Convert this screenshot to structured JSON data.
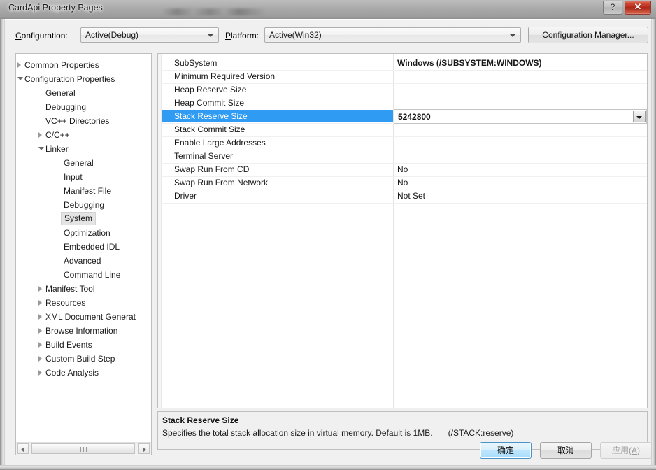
{
  "window": {
    "title": "CardApi Property Pages",
    "help_button": "?",
    "close_button": "✕"
  },
  "configbar": {
    "configuration_label": "Configuration:",
    "configuration_label_accel": "C",
    "configuration_value": "Active(Debug)",
    "platform_label": "Platform:",
    "platform_label_accel": "P",
    "platform_value": "Active(Win32)",
    "config_manager_button": "Configuration Manager...",
    "config_manager_accel": "o"
  },
  "tree": {
    "items": [
      {
        "label": "Common Properties",
        "indent": 12,
        "expander": "collapsed",
        "selected": false
      },
      {
        "label": "Configuration Properties",
        "indent": 12,
        "expander": "expanded",
        "selected": false
      },
      {
        "label": "General",
        "indent": 42,
        "expander": "none",
        "selected": false
      },
      {
        "label": "Debugging",
        "indent": 42,
        "expander": "none",
        "selected": false
      },
      {
        "label": "VC++ Directories",
        "indent": 42,
        "expander": "none",
        "selected": false
      },
      {
        "label": "C/C++",
        "indent": 42,
        "expander": "collapsed",
        "selected": false
      },
      {
        "label": "Linker",
        "indent": 42,
        "expander": "expanded",
        "selected": false
      },
      {
        "label": "General",
        "indent": 68,
        "expander": "none",
        "selected": false
      },
      {
        "label": "Input",
        "indent": 68,
        "expander": "none",
        "selected": false
      },
      {
        "label": "Manifest File",
        "indent": 68,
        "expander": "none",
        "selected": false
      },
      {
        "label": "Debugging",
        "indent": 68,
        "expander": "none",
        "selected": false
      },
      {
        "label": "System",
        "indent": 68,
        "expander": "none",
        "selected": true
      },
      {
        "label": "Optimization",
        "indent": 68,
        "expander": "none",
        "selected": false
      },
      {
        "label": "Embedded IDL",
        "indent": 68,
        "expander": "none",
        "selected": false
      },
      {
        "label": "Advanced",
        "indent": 68,
        "expander": "none",
        "selected": false
      },
      {
        "label": "Command Line",
        "indent": 68,
        "expander": "none",
        "selected": false
      },
      {
        "label": "Manifest Tool",
        "indent": 42,
        "expander": "collapsed",
        "selected": false
      },
      {
        "label": "Resources",
        "indent": 42,
        "expander": "collapsed",
        "selected": false
      },
      {
        "label": "XML Document Generat",
        "indent": 42,
        "expander": "collapsed",
        "selected": false
      },
      {
        "label": "Browse Information",
        "indent": 42,
        "expander": "collapsed",
        "selected": false
      },
      {
        "label": "Build Events",
        "indent": 42,
        "expander": "collapsed",
        "selected": false
      },
      {
        "label": "Custom Build Step",
        "indent": 42,
        "expander": "collapsed",
        "selected": false
      },
      {
        "label": "Code Analysis",
        "indent": 42,
        "expander": "collapsed",
        "selected": false
      }
    ]
  },
  "grid": {
    "rows": [
      {
        "name": "SubSystem",
        "value": "Windows (/SUBSYSTEM:WINDOWS)",
        "bold": true,
        "selected": false
      },
      {
        "name": "Minimum Required Version",
        "value": "",
        "bold": false,
        "selected": false
      },
      {
        "name": "Heap Reserve Size",
        "value": "",
        "bold": false,
        "selected": false
      },
      {
        "name": "Heap Commit Size",
        "value": "",
        "bold": false,
        "selected": false
      },
      {
        "name": "Stack Reserve Size",
        "value": "5242800",
        "bold": true,
        "selected": true
      },
      {
        "name": "Stack Commit Size",
        "value": "",
        "bold": false,
        "selected": false
      },
      {
        "name": "Enable Large Addresses",
        "value": "",
        "bold": false,
        "selected": false
      },
      {
        "name": "Terminal Server",
        "value": "",
        "bold": false,
        "selected": false
      },
      {
        "name": "Swap Run From CD",
        "value": "No",
        "bold": false,
        "selected": false
      },
      {
        "name": "Swap Run From Network",
        "value": "No",
        "bold": false,
        "selected": false
      },
      {
        "name": "Driver",
        "value": "Not Set",
        "bold": false,
        "selected": false
      }
    ]
  },
  "description": {
    "title": "Stack Reserve Size",
    "body": "Specifies the total stack allocation size in virtual memory. Default is 1MB.",
    "switch": "(/STACK:reserve)"
  },
  "buttons": {
    "ok": "确定",
    "cancel": "取消",
    "apply": "应用(",
    "apply_accel": "A",
    "apply_suffix": ")"
  },
  "colors": {
    "selection_blue": "#2f9bf2",
    "close_button_red": "#b6291a",
    "default_button_blue": "#a6dcfd",
    "panel_background": "#f0f0f0"
  }
}
